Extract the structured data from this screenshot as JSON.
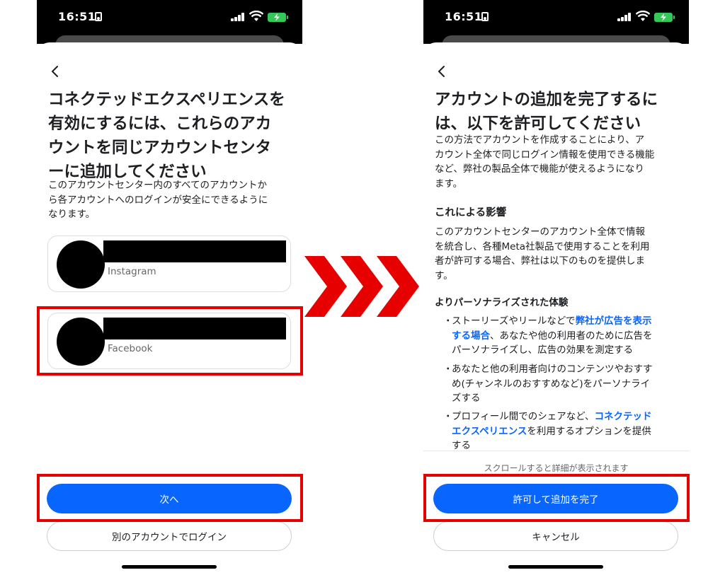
{
  "status_bar": {
    "time": "16:51"
  },
  "left_screen": {
    "title_lines": [
      "コネクテッドエクスペリエンスを",
      "有効にするには、これらのアカ",
      "ウントを同じアカウントセンタ",
      "ーに追加してください"
    ],
    "description_lines": [
      "このアカウントセンター内のすべてのアカウントか",
      "ら各アカウントへのログインが安全にできるように",
      "なります。"
    ],
    "accounts": [
      {
        "platform": "Instagram"
      },
      {
        "platform": "Facebook"
      }
    ],
    "next_button": "次へ",
    "other_account_button": "別のアカウントでログイン"
  },
  "right_screen": {
    "title_lines": [
      "アカウントの追加を完了するに",
      "は、以下を許可してください"
    ],
    "description_lines": [
      "この方法でアカウントを作成することにより、ア",
      "カウント全体で同じログイン情報を使用できる機能",
      "など、弊社の製品全体で機能が使えるようになり",
      "ます。"
    ],
    "impact_heading": "これによる影響",
    "impact_lines": [
      "このアカウントセンターのアカウント全体で情報",
      "を統合し、各種Meta社製品で使用することを利用",
      "者が許可する場合、弊社は以下のものを提供しま",
      "す。"
    ],
    "personalized_heading": "よりパーソナライズされた体験",
    "bullet1": {
      "part1": "ストーリーズやリールなどで",
      "link1": "弊社が広告を表示",
      "link2": "する場合",
      "part2": "、あなたや他の利用者のために広告を",
      "line3": "パーソナライズし、広告の効果を測定する"
    },
    "bullet2": {
      "line1": "あなたと他の利用者向けのコンテンツやおすす",
      "line2": "め(チャンネルのおすすめなど)をパーソナライ",
      "line3": "ズする"
    },
    "bullet3": {
      "part1": "プロフィール間でのシェアなど、",
      "link1": "コネクテッド",
      "link2": "エクスペリエンス",
      "part2": "を利用するオプションを提供",
      "line3": "する"
    },
    "scroll_hint": "スクロールすると詳細が表示されます",
    "allow_button": "許可して追加を完了",
    "cancel_button": "キャンセル"
  },
  "colors": {
    "primary": "#0866ff",
    "highlight": "#e60000",
    "link": "#0866ff"
  }
}
